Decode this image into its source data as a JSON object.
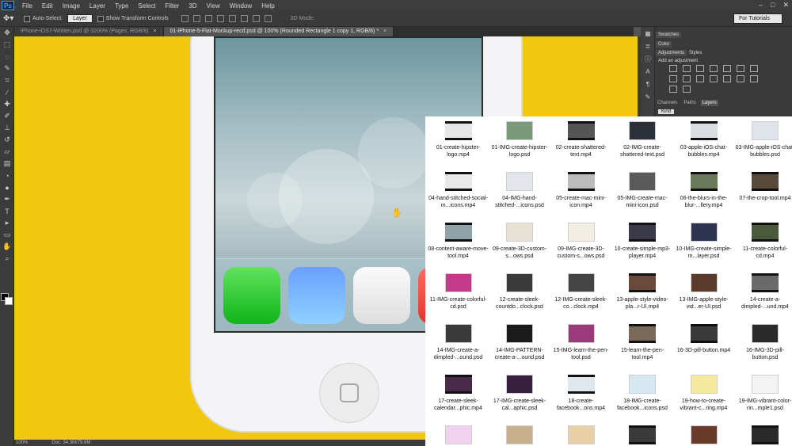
{
  "app": {
    "logo": "Ps"
  },
  "menu": [
    "File",
    "Edit",
    "Image",
    "Layer",
    "Type",
    "Select",
    "Filter",
    "3D",
    "View",
    "Window",
    "Help"
  ],
  "window_controls": [
    "–",
    "□",
    "✕"
  ],
  "options": {
    "auto_select_label": "Auto-Select:",
    "auto_select_value": "Layer",
    "transform_label": "Show Transform Controls",
    "mode_3d": "3D Mode:",
    "workspace": "For Tutorials"
  },
  "tabs": [
    {
      "label": "iPhone-iOS7-Written.psd @ 3200% (Pages, RGB/8)",
      "active": false
    },
    {
      "label": "01-iPhone-5-Flat-Mockup-recd.psd @ 100% (Rounded Rectangle 1 copy 1, RGB/8) *",
      "active": true
    }
  ],
  "status": {
    "zoom": "100%",
    "doc": "Doc: 34.3M/79.6M"
  },
  "panels": {
    "top_tabs": [
      "Swatches",
      "Color"
    ],
    "adjustments_tabs": [
      "Adjustments",
      "Styles"
    ],
    "adjustments_title": "Add an adjustment",
    "layers_tabs": [
      "Channels",
      "Paths",
      "Layers"
    ],
    "kind": "Kind"
  },
  "colors": {
    "canvas": "#f1c80f",
    "app_green": "#0fb41a",
    "app_blue": "#6aa0ff",
    "app_red": "#e0362b"
  },
  "finder_files": [
    {
      "name": "01-create-hipster-logo.mp4",
      "thumb": "#e6e6e6",
      "video": true
    },
    {
      "name": "01-IMG-create-hipster-logo.psd",
      "thumb": "#7a9a7a",
      "video": false
    },
    {
      "name": "02-create-shattered-text.mp4",
      "thumb": "#555555",
      "video": true
    },
    {
      "name": "02-IMG-create-shattered-text.psd",
      "thumb": "#2a2f3a",
      "video": false
    },
    {
      "name": "03-apple-iOS-chat-bubbles.mp4",
      "thumb": "#d9dde2",
      "video": true
    },
    {
      "name": "03-IMG-apple-iOS-chat-bubbles.psd",
      "thumb": "#dfe4ea",
      "video": false
    },
    {
      "name": "04-hand-stitched-social-m...icons.mp4",
      "thumb": "#e8e8e8",
      "video": true
    },
    {
      "name": "04-IMG-hand-stitched-...icons.psd",
      "thumb": "#e2e5ec",
      "video": false
    },
    {
      "name": "05-create-mac-mini-icon.mp4",
      "thumb": "#bcbcbc",
      "video": true
    },
    {
      "name": "05-IMG-create-mac-mini-icon.psd",
      "thumb": "#5a5a5a",
      "video": false
    },
    {
      "name": "06-the-blurs-in-the-blur-...llery.mp4",
      "thumb": "#6b7a5a",
      "video": true
    },
    {
      "name": "07-the-crop-tool.mp4",
      "thumb": "#5a4a3a",
      "video": true
    },
    {
      "name": "08-content-aware-move-tool.mp4",
      "thumb": "#8fa3a8",
      "video": true
    },
    {
      "name": "09-create-3D-custom-s...ows.psd",
      "thumb": "#e8e2d5",
      "video": false
    },
    {
      "name": "09-IMG-create-3D-custom-s...ows.psd",
      "thumb": "#f2eee4",
      "video": false
    },
    {
      "name": "10-create-simple-mp3-player.mp4",
      "thumb": "#3a3a4a",
      "video": true
    },
    {
      "name": "10-IMG-create-simple-m...layer.psd",
      "thumb": "#2e3450",
      "video": false
    },
    {
      "name": "11-create-colorful-cd.mp4",
      "thumb": "#4a5a3a",
      "video": true
    },
    {
      "name": "11-IMG-create-colorful-cd.psd",
      "thumb": "#c23a8a",
      "video": false
    },
    {
      "name": "12-create-sleek-countdo...clock.psd",
      "thumb": "#3a3a3a",
      "video": false
    },
    {
      "name": "12-IMG-create-sleek-co...clock.mp4",
      "thumb": "#444444",
      "video": false
    },
    {
      "name": "13-apple-style-video-pla...r-UI.mp4",
      "thumb": "#6a4a3a",
      "video": true
    },
    {
      "name": "13-IMG-apple-style-vid...er-UI.psd",
      "thumb": "#5a3a2a",
      "video": false
    },
    {
      "name": "14-create-a-dimpled-...und.mp4",
      "thumb": "#6a6a6a",
      "video": true
    },
    {
      "name": "14-IMG-create-a-dimpled-...ound.psd",
      "thumb": "#3a3a3a",
      "video": false
    },
    {
      "name": "14-IMG-PATTERN-create-a-...ound.psd",
      "thumb": "#1a1a1a",
      "video": false
    },
    {
      "name": "15-IMG-learn-the-pen-tool.psd",
      "thumb": "#9a3a7a",
      "video": false
    },
    {
      "name": "15-learn-the-pen-tool.mp4",
      "thumb": "#7a6a5a",
      "video": true
    },
    {
      "name": "16-3D-pill-button.mp4",
      "thumb": "#3a3a3a",
      "video": true
    },
    {
      "name": "16-IMG-3D-pill-button.psd",
      "thumb": "#2a2a2a",
      "video": false
    },
    {
      "name": "17-create-sleek-calendar...phic.mp4",
      "thumb": "#4a2a4a",
      "video": true
    },
    {
      "name": "17-IMG-create-sleek-cal...aphic.psd",
      "thumb": "#3a2040",
      "video": false
    },
    {
      "name": "18-create-facebook...ons.mp4",
      "thumb": "#dfe8ee",
      "video": true
    },
    {
      "name": "18-IMG-create-facebook...icons.psd",
      "thumb": "#d8e8f2",
      "video": false
    },
    {
      "name": "19-how-to-create-vibrant-c...ring.mp4",
      "thumb": "#f5e9a0",
      "video": false
    },
    {
      "name": "19-IMG-vibrant-color-rin...mple1.psd",
      "thumb": "#f3f3f3",
      "video": false
    },
    {
      "name": "",
      "thumb": "#f2d0f0",
      "video": false
    },
    {
      "name": "",
      "thumb": "#c8b08a",
      "video": false
    },
    {
      "name": "",
      "thumb": "#e8cfa8",
      "video": false
    },
    {
      "name": "",
      "thumb": "#3a3a3a",
      "video": true
    },
    {
      "name": "",
      "thumb": "#6a3a2a",
      "video": false
    },
    {
      "name": "",
      "thumb": "#2a2a2a",
      "video": true
    }
  ]
}
